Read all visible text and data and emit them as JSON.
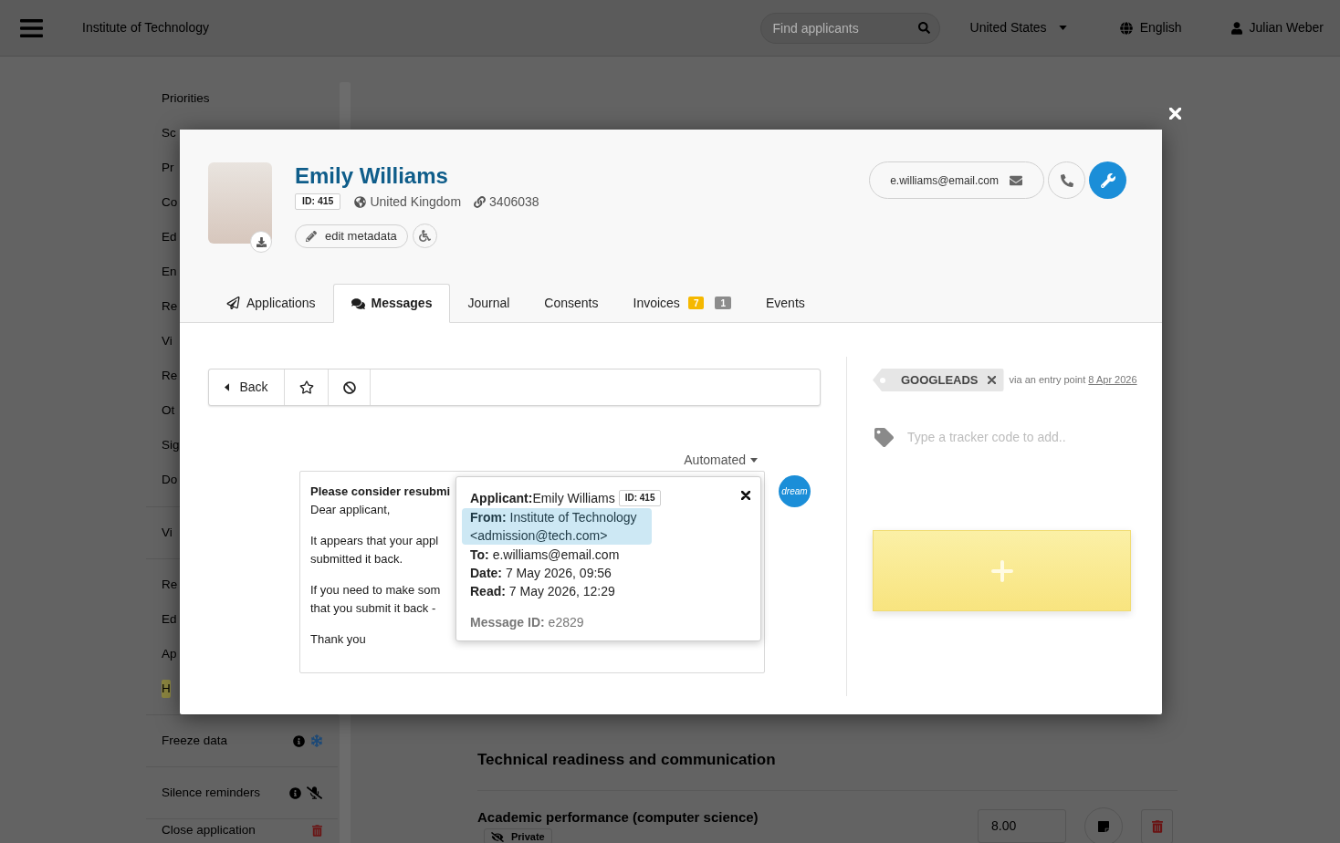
{
  "top_bar": {
    "institution": "Institute of Technology",
    "search": {
      "placeholder": "Find applicants"
    },
    "country": "United States",
    "language": "English",
    "user": "Julian Weber"
  },
  "sidebar": {
    "groups": [
      {
        "items": [
          {
            "label": "Priorities",
            "kind": "link",
            "highlighted": false
          },
          {
            "label": "Sc",
            "kind": "link",
            "highlighted": false
          },
          {
            "label": "Pr",
            "kind": "link",
            "highlighted": false
          },
          {
            "label": "Co",
            "kind": "link",
            "highlighted": false
          },
          {
            "label": "Ed",
            "kind": "link",
            "highlighted": false
          },
          {
            "label": "En",
            "kind": "link",
            "highlighted": false
          },
          {
            "label": "Re",
            "kind": "link",
            "highlighted": false
          },
          {
            "label": "Vi",
            "kind": "link",
            "highlighted": false
          },
          {
            "label": "Re",
            "kind": "link",
            "highlighted": false
          },
          {
            "label": "Ot",
            "kind": "link",
            "highlighted": false
          },
          {
            "label": "Sig",
            "kind": "link",
            "highlighted": false
          },
          {
            "label": "Do",
            "kind": "link",
            "highlighted": false
          }
        ]
      },
      {
        "items": [
          {
            "label": "Vi",
            "kind": "link",
            "highlighted": false
          }
        ]
      },
      {
        "items": [
          {
            "label": "Re",
            "kind": "link",
            "highlighted": false
          },
          {
            "label": "Ed",
            "kind": "link",
            "highlighted": false
          },
          {
            "label": "Ap",
            "kind": "link",
            "highlighted": false
          },
          {
            "label": "H",
            "kind": "link",
            "highlighted": true
          }
        ]
      },
      {
        "items": [
          {
            "label": "Freeze data",
            "kind": "freeze",
            "highlighted": false
          }
        ]
      },
      {
        "items": [
          {
            "label": "Silence reminders",
            "kind": "mute",
            "highlighted": false
          }
        ]
      },
      {
        "items": [
          {
            "label": "Close application",
            "kind": "close",
            "highlighted": false
          }
        ]
      }
    ]
  },
  "main": {
    "section_title": "Technical readiness and communication",
    "criteria": [
      {
        "title": "Academic performance (computer science)",
        "visibility": "Private",
        "score": "8.00"
      }
    ]
  },
  "applicant_modal": {
    "profile": {
      "name": "Emily Williams",
      "id_badge": "ID: 415",
      "country": "United Kingdom",
      "reference": "3406038",
      "edit_button": "edit metadata"
    },
    "contact": {
      "email": "e.williams@email.com"
    },
    "tabs": [
      {
        "label": "Applications",
        "selected": false
      },
      {
        "label": "Messages",
        "selected": true
      },
      {
        "label": "Journal",
        "selected": false
      },
      {
        "label": "Consents",
        "selected": false
      },
      {
        "label": "Invoices",
        "selected": false,
        "badges": [
          {
            "text": "7",
            "color": "#f5b800"
          },
          {
            "text": "1",
            "color": "#8c8c8c"
          }
        ]
      },
      {
        "label": "Events",
        "selected": false
      }
    ],
    "message_toolbar": {
      "back_button": "Back"
    },
    "message": {
      "category": "Automated",
      "sender_logo": "dream",
      "subject": "Please consider resubmi",
      "paragraphs": [
        [
          "Dear applicant,"
        ],
        [
          "It appears that your appl",
          "submitted it back."
        ],
        [
          "If you need to make som",
          "that you submit it back -"
        ],
        [
          "Thank you"
        ]
      ]
    },
    "message_details": {
      "applicant": {
        "label": "Applicant:",
        "value": "Emily Williams",
        "id_badge": "ID: 415"
      },
      "fields": [
        {
          "label": "From:",
          "value": "Institute of Technology <admission@tech.com>",
          "highlighted": true
        },
        {
          "label": "To:",
          "value": "e.williams@email.com",
          "highlighted": false
        },
        {
          "label": "Date:",
          "value": "7 May 2026, 09:56",
          "highlighted": false
        },
        {
          "label": "Read:",
          "value": "7 May 2026, 12:29",
          "highlighted": false
        }
      ],
      "message_id": {
        "label": "Message ID:",
        "value": "e2829"
      }
    },
    "trackers": {
      "tags": [
        {
          "code": "GOOGLEADS",
          "source": "via an entry point",
          "date": "8 Apr 2026"
        }
      ],
      "input": {
        "placeholder": "Type a tracker code to add.."
      }
    }
  }
}
